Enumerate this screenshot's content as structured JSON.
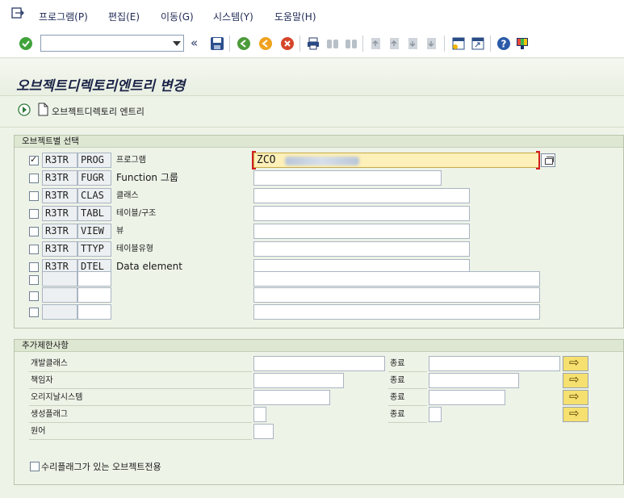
{
  "menu": {
    "items": [
      "프로그램(P)",
      "편집(E)",
      "이동(G)",
      "시스템(Y)",
      "도움말(H)"
    ]
  },
  "toolbar": {
    "command_value": "",
    "icons": [
      "enter-icon",
      "back-icon",
      "save-icon",
      "back-green-icon",
      "exit-icon",
      "cancel-icon",
      "print-icon",
      "find-icon",
      "find-next-icon",
      "first-page-icon",
      "prev-page-icon",
      "next-page-icon",
      "last-page-icon",
      "new-session-icon",
      "shortcut-icon",
      "help-icon",
      "layout-icon"
    ]
  },
  "title": "오브젝트디렉토리엔트리 변경",
  "app_toolbar": {
    "entry_button_label": "오브젝트디렉토리 엔트리"
  },
  "object_selection": {
    "title": "오브젝트별 선택",
    "rows": [
      {
        "checked": true,
        "pgmid": "R3TR",
        "type": "PROG",
        "desc": "프로그램",
        "value": "ZCO"
      },
      {
        "checked": false,
        "pgmid": "R3TR",
        "type": "FUGR",
        "desc": "Function 그룹",
        "value": ""
      },
      {
        "checked": false,
        "pgmid": "R3TR",
        "type": "CLAS",
        "desc": "클래스",
        "value": ""
      },
      {
        "checked": false,
        "pgmid": "R3TR",
        "type": "TABL",
        "desc": "테이블/구조",
        "value": ""
      },
      {
        "checked": false,
        "pgmid": "R3TR",
        "type": "VIEW",
        "desc": "뷰",
        "value": ""
      },
      {
        "checked": false,
        "pgmid": "R3TR",
        "type": "TTYP",
        "desc": "테이블유형",
        "value": ""
      },
      {
        "checked": false,
        "pgmid": "R3TR",
        "type": "DTEL",
        "desc": "Data element",
        "value": ""
      },
      {
        "checked": false,
        "pgmid": "",
        "type": "",
        "desc": "",
        "value": ""
      },
      {
        "checked": false,
        "pgmid": "",
        "type": "",
        "desc": "",
        "value": ""
      },
      {
        "checked": false,
        "pgmid": "",
        "type": "",
        "desc": "",
        "value": ""
      }
    ]
  },
  "restrictions": {
    "title": "추가제한사항",
    "rows": [
      {
        "label": "개발클래스",
        "to_label": "종료"
      },
      {
        "label": "책임자",
        "to_label": "종료"
      },
      {
        "label": "오리지날시스템",
        "to_label": "종료"
      },
      {
        "label": "생성플래그",
        "to_label": "종료"
      },
      {
        "label": "원어",
        "to_label": ""
      }
    ],
    "checkbox_label": "수리플래그가 있는 오브젝트전용"
  }
}
